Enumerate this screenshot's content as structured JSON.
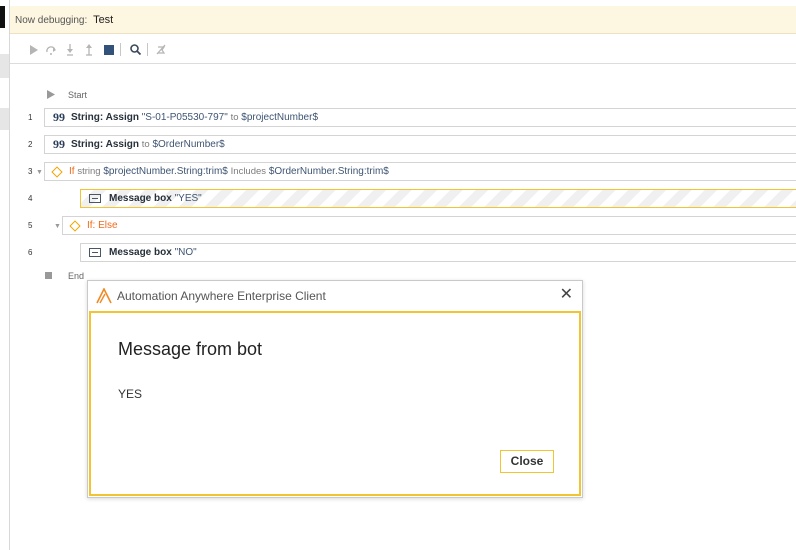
{
  "debug": {
    "label": "Now debugging:",
    "task_name": "Test"
  },
  "toolbar": [
    "run-icon",
    "step-over-icon",
    "step-into-icon",
    "step-out-icon",
    "stop-icon",
    "search-icon",
    "disable-breakpoints-icon"
  ],
  "flow": {
    "start": "Start",
    "end": "End",
    "lines": [
      {
        "n": "1",
        "action": "String: Assign",
        "value": "\"S-01-P05530-797\"",
        "to": "to",
        "var": "$projectNumber$"
      },
      {
        "n": "2",
        "action": "String: Assign",
        "to": "to",
        "var": "$OrderNumber$"
      },
      {
        "n": "3",
        "if": "If",
        "kw": "string",
        "left": "$projectNumber.String:trim$",
        "op": "Includes",
        "right": "$OrderNumber.String:trim$"
      },
      {
        "n": "4",
        "action": "Message box",
        "value": "\"YES\""
      },
      {
        "n": "5",
        "action": "If: Else"
      },
      {
        "n": "6",
        "action": "Message box",
        "value": "\"NO\""
      }
    ]
  },
  "dialog": {
    "title": "Automation Anywhere Enterprise Client",
    "heading": "Message from bot",
    "message": "YES",
    "close_label": "Close"
  },
  "colors": {
    "accent": "#f3c432",
    "keyword": "#f06a1a",
    "variable": "#3e5573",
    "debug_bar": "#fdf6e0"
  }
}
